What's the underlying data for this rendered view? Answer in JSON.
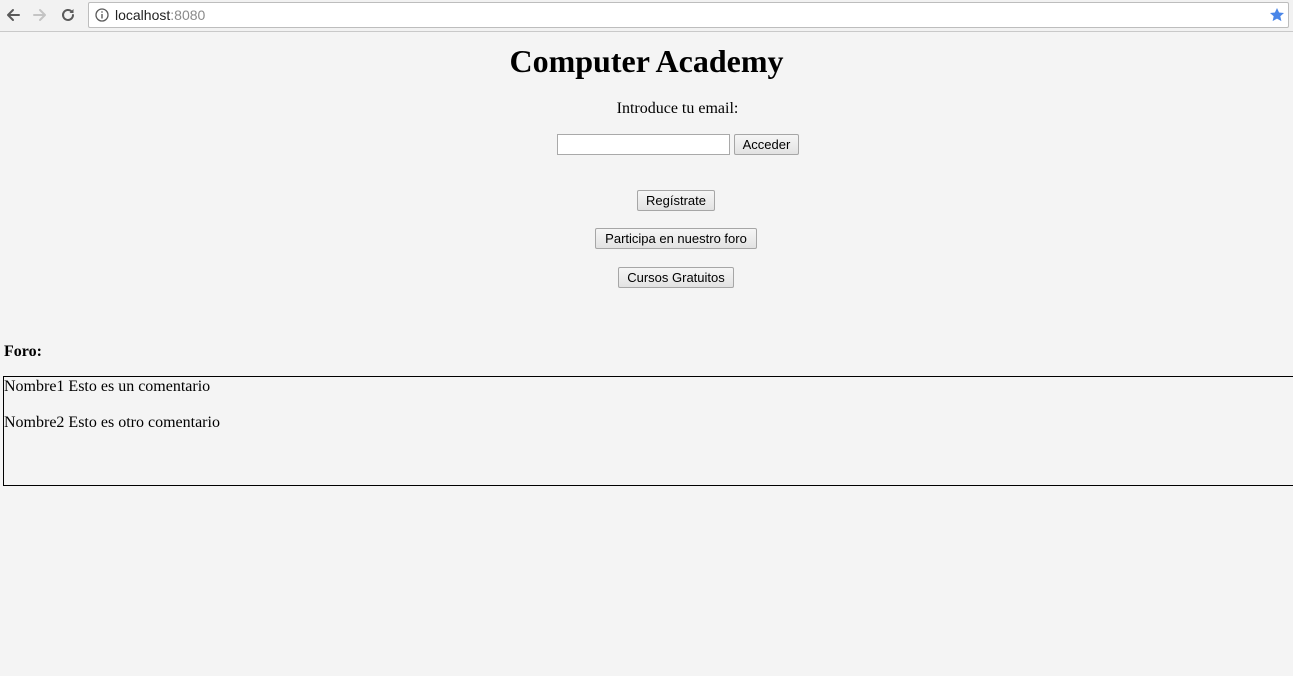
{
  "browser": {
    "url_host": "localhost",
    "url_port": ":8080",
    "icons": [
      "back-arrow-icon",
      "forward-arrow-icon",
      "reload-icon",
      "info-icon",
      "bookmark-star-icon"
    ],
    "star_color": "#4a86e8"
  },
  "page": {
    "title": "Computer Academy",
    "email_label": "Introduce tu email:",
    "email_input": {
      "value": "",
      "placeholder": ""
    },
    "buttons": {
      "acceder": "Acceder",
      "registrate": "Regístrate",
      "foro": "Participa en nuestro foro",
      "cursos": "Cursos Gratuitos"
    },
    "foro_label": "Foro:",
    "comments": [
      {
        "text": "Nombre1 Esto es un comentario"
      },
      {
        "text": "Nombre2 Esto es otro comentario"
      }
    ]
  }
}
